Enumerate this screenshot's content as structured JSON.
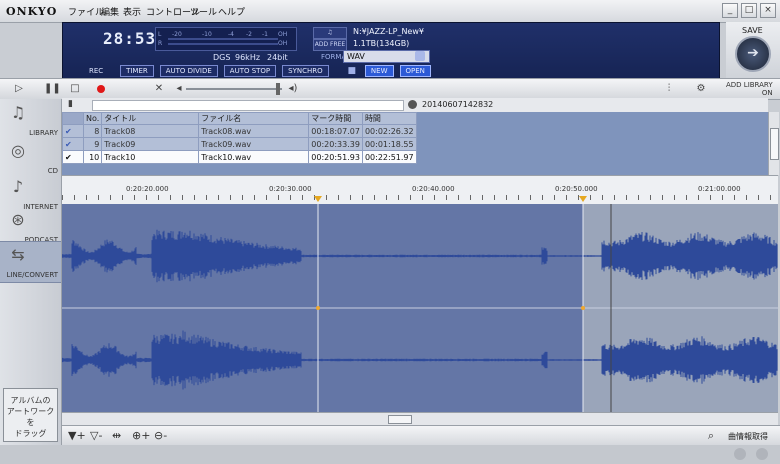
{
  "app": {
    "logo": "ONKYO"
  },
  "menu": [
    "ファイル",
    "編集",
    "表示",
    "コントロール",
    "ツール",
    "ヘルプ"
  ],
  "window_buttons": [
    "minimize-icon",
    "maximize-icon",
    "close-icon"
  ],
  "display": {
    "clock": "28:53",
    "level_labels": [
      "L",
      "-20",
      "-10",
      "-4",
      "-2",
      "-1",
      "OH",
      "R",
      "OH"
    ],
    "path": "N:¥JAZZ-LP_New¥",
    "free_label": "ADD FREE",
    "free": "1.1TB(134GB)",
    "source": "DGS",
    "samplerate": "96kHz",
    "bits": "24bit",
    "format_label": "FORMAT",
    "format": "WAV",
    "rec_label": "REC",
    "rec_buttons": [
      "TIMER",
      "AUTO DIVIDE",
      "AUTO STOP",
      "SYNCHRO"
    ],
    "file_buttons": [
      "NEW",
      "OPEN"
    ]
  },
  "save": {
    "label": "SAVE"
  },
  "transport": {
    "add_library": "ADD LIBRARY",
    "on": "ON"
  },
  "nav": [
    {
      "label": "LIBRARY",
      "icon": "library-icon"
    },
    {
      "label": "CD",
      "icon": "cd-icon"
    },
    {
      "label": "INTERNET",
      "icon": "internet-icon"
    },
    {
      "label": "PODCAST",
      "icon": "podcast-icon"
    },
    {
      "label": "LINE/CONVERT",
      "icon": "line-convert-icon"
    }
  ],
  "artwork": {
    "line1": "アルバムの",
    "line2": "アートワークを",
    "line3": "ドラッグ"
  },
  "info": {
    "id": "20140607142832"
  },
  "table": {
    "headers": [
      "No.",
      "タイトル",
      "ファイル名",
      "マーク時間",
      "時間"
    ],
    "rows": [
      {
        "no": "8",
        "title": "Track08",
        "file": "Track08.wav",
        "mark": "00:18:07.07",
        "time": "00:02:26.32"
      },
      {
        "no": "9",
        "title": "Track09",
        "file": "Track09.wav",
        "mark": "00:20:33.39",
        "time": "00:01:18.55"
      },
      {
        "no": "10",
        "title": "Track10",
        "file": "Track10.wav",
        "mark": "00:20:51.93",
        "time": "00:22:51.97"
      }
    ]
  },
  "timeline": {
    "ticks": [
      "0:20:20.000",
      "0:20:30.000",
      "0:20:40.000",
      "0:20:50.000",
      "0:21:00.000"
    ]
  },
  "bottom": {
    "fetch": "曲情報取得"
  }
}
